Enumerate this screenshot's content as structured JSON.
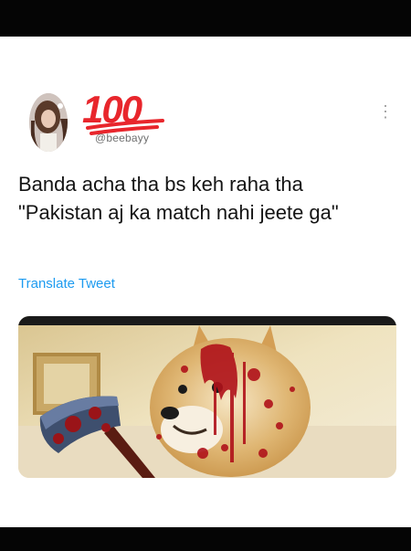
{
  "tweet": {
    "handle": "@beebayy",
    "name_emoji": "100",
    "more_icon": "⋮",
    "text": "Banda acha tha bs keh raha tha \"Pakistan aj ka match nahi jeete ga\"",
    "translate_label": "Translate Tweet"
  },
  "media": {
    "description_icons": [
      "doge-icon",
      "axe-icon"
    ]
  }
}
